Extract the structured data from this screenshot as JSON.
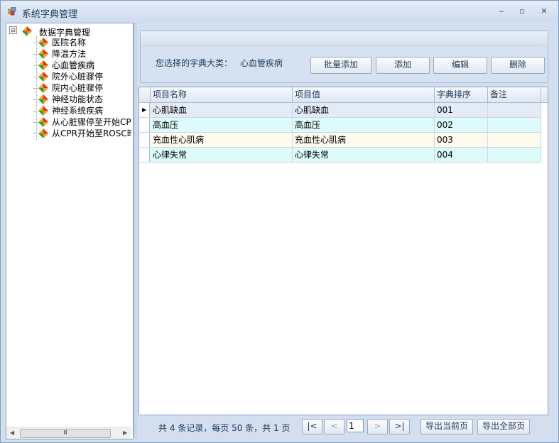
{
  "window": {
    "title": "系统字典管理",
    "controls": {
      "minimize": "‒",
      "maximize": "▫",
      "close": "✕"
    }
  },
  "tree": {
    "root": "数据字典管理",
    "expander": "⊟",
    "items": [
      {
        "label": "医院名称"
      },
      {
        "label": "降温方法"
      },
      {
        "label": "心血管疾病",
        "selected": true
      },
      {
        "label": "院外心脏骤停"
      },
      {
        "label": "院内心脏骤停"
      },
      {
        "label": "神经功能状态"
      },
      {
        "label": "神经系统疾病"
      },
      {
        "label": "从心脏骤停至开始CPR"
      },
      {
        "label": "从CPR开始至ROSC时间"
      }
    ],
    "scrollbar": {
      "left": "◀",
      "right": "▶",
      "thumb": "Ⅲ"
    }
  },
  "header": {
    "category_label": "您选择的字典大类：",
    "category_value": "心血管疾病",
    "buttons": {
      "batch_add": "批量添加",
      "add": "添加",
      "edit": "编辑",
      "delete": "删除"
    }
  },
  "grid": {
    "columns": [
      "项目名称",
      "项目值",
      "字典排序",
      "备注"
    ],
    "current_row_marker": "▶",
    "rows": [
      {
        "name": "心肌缺血",
        "value": "心肌缺血",
        "order": "001",
        "note": ""
      },
      {
        "name": "高血压",
        "value": "高血压",
        "order": "002",
        "note": ""
      },
      {
        "name": "充血性心肌病",
        "value": "充血性心肌病",
        "order": "003",
        "note": ""
      },
      {
        "name": "心律失常",
        "value": "心律失常",
        "order": "004",
        "note": ""
      }
    ],
    "row_colors": [
      "#e2ebf6",
      "#ddfbfb",
      "#fdfaee",
      "#ddfbfb"
    ]
  },
  "pager": {
    "summary": "共 4 条记录，每页 50 条，共 1 页",
    "first": "|<",
    "prev": "<",
    "page": "1",
    "next": ">",
    "last": ">|",
    "export_current": "导出当前页",
    "export_all": "导出全部页"
  },
  "colors": {
    "accent": "#1e395b",
    "tree_icon_red": "#e0302a",
    "tree_icon_green": "#1ea04a",
    "tree_icon_orange": "#f2a21d"
  }
}
